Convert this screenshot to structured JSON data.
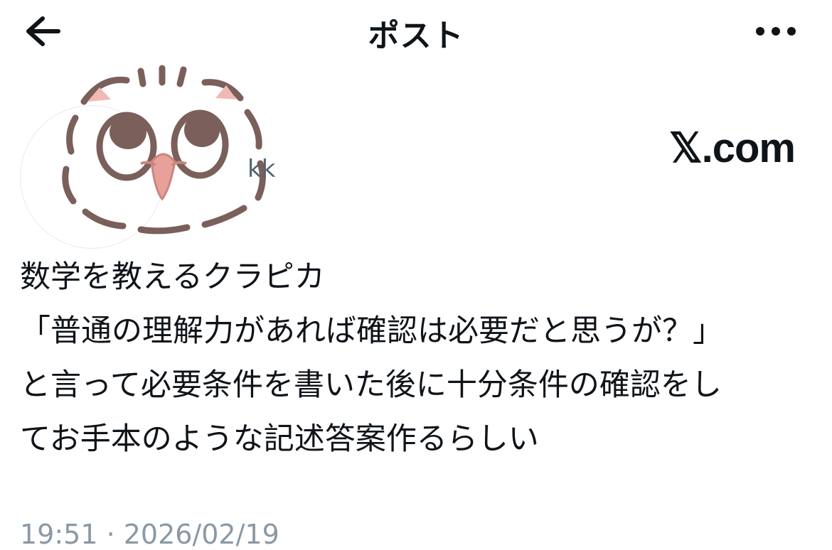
{
  "header": {
    "title": "ポスト",
    "back_icon": "arrow-left-icon",
    "more_icon": "more-horizontal-icon"
  },
  "author": {
    "handle_fragment": "kk",
    "avatar_icon": "cartoon-owl-avatar"
  },
  "watermark": {
    "text": "𝕏.com"
  },
  "post": {
    "lines": [
      "数学を教えるクラピカ",
      "「普通の理解力があれば確認は必要だと思うが？」",
      "と言って必要条件を書いた後に十分条件の確認をし",
      "てお手本のような記述答案作るらしい"
    ]
  },
  "meta": {
    "timestamp": "19:51 · 2026/02/19"
  },
  "colors": {
    "text": "#0f1419",
    "muted": "#536471",
    "timestamp": "#8b98a5",
    "avatar_line": "#7a5f5a",
    "avatar_pink": "#f2b8b4"
  }
}
